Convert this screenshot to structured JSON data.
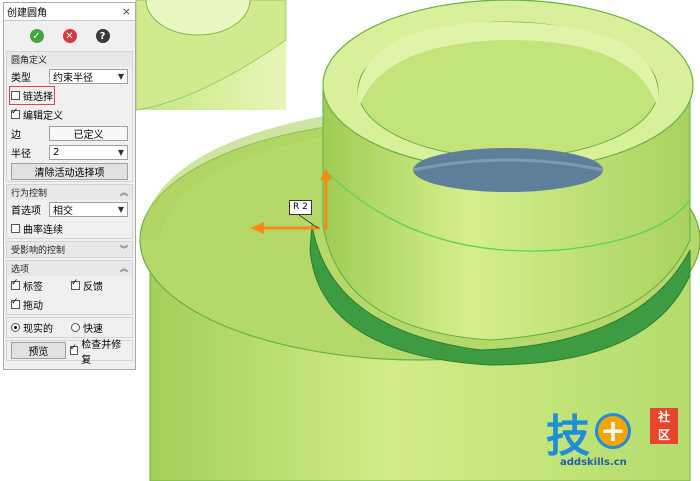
{
  "dialog": {
    "title": "创建圆角",
    "close_glyph": "×",
    "actions": {
      "ok_glyph": "✓",
      "cancel_glyph": "✕",
      "help_glyph": "?"
    }
  },
  "fillet_def": {
    "header": "圆角定义",
    "type_label": "类型",
    "type_value": "约束半径",
    "chain_select": "链选择",
    "edit_def": "编辑定义",
    "edge_label": "边",
    "edge_value": "已定义",
    "radius_label": "半径",
    "radius_value": "2",
    "clear_btn": "清除活动选择项"
  },
  "behavior": {
    "header": "行为控制",
    "pref_label": "首选项",
    "pref_value": "相交",
    "curvature": "曲率连续"
  },
  "affected": {
    "header": "受影响的控制"
  },
  "options": {
    "header": "选项",
    "label_cb": "标签",
    "feedback_cb": "反馈",
    "drag_cb": "拖动",
    "realistic": "现实的",
    "fast": "快速",
    "preview_btn": "预览",
    "check_repair": "检查并修复"
  },
  "viewport": {
    "radius_tag": "R 2",
    "logo_main": "技",
    "logo_plus": "+",
    "logo_side_1": "社",
    "logo_side_2": "区",
    "logo_url": "addskills.cn"
  },
  "colors": {
    "part_face": "#c8e87a",
    "part_edge": "#4fb04a",
    "fillet_green": "#3c9a3f",
    "bore_blue": "#5d7f99",
    "arrow_orange": "#f28b18"
  }
}
